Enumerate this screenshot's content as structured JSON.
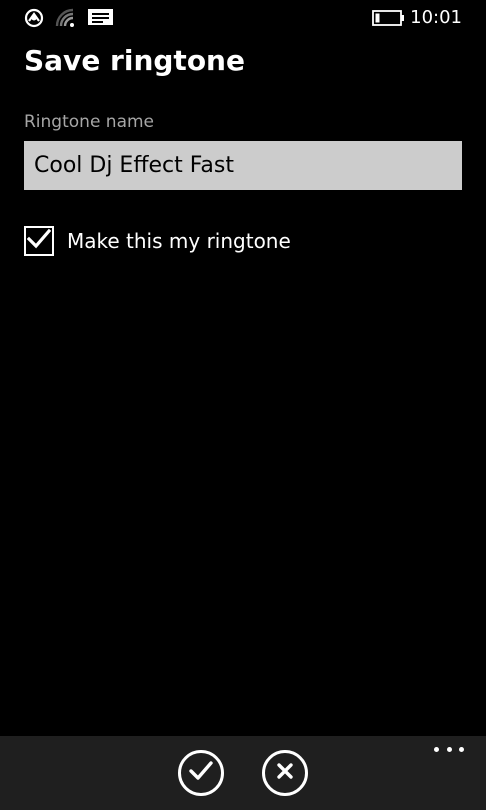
{
  "status_bar": {
    "time": "10:01",
    "icons": [
      "data-sense-icon",
      "wifi-icon",
      "message-icon",
      "battery-icon"
    ]
  },
  "page": {
    "title": "Save ringtone"
  },
  "form": {
    "name_label": "Ringtone name",
    "name_value": "Cool Dj Effect Fast",
    "checkbox_label": "Make this my ringtone",
    "checkbox_checked": true
  },
  "app_bar": {
    "buttons": [
      "check-icon",
      "cancel-icon"
    ],
    "more_icon": "ellipsis-icon",
    "background": "#1f1f1f"
  },
  "colors": {
    "background": "#000000",
    "input_background": "#cccccc",
    "label": "#a6a6a6"
  }
}
